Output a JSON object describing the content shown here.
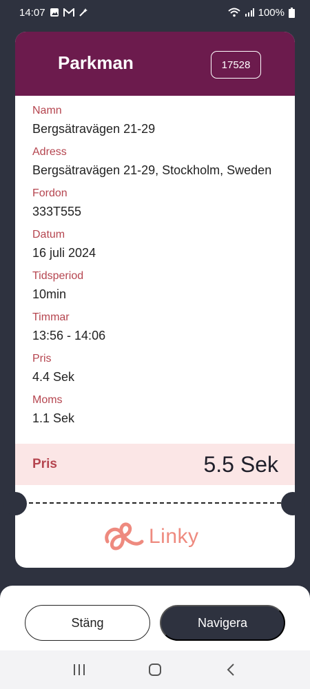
{
  "status_bar": {
    "time": "14:07",
    "battery": "100%",
    "icons_left": [
      "gallery-icon",
      "gmail-icon",
      "wand-icon"
    ],
    "icons_right": [
      "wifi-icon",
      "signal-icon",
      "battery-icon"
    ]
  },
  "receipt": {
    "title": "Parkman",
    "code": "17528",
    "details": [
      {
        "label": "Namn",
        "value": "Bergsätravägen 21-29"
      },
      {
        "label": "Adress",
        "value": "Bergsätravägen 21-29, Stockholm, Sweden"
      },
      {
        "label": "Fordon",
        "value": "333T555"
      },
      {
        "label": "Datum",
        "value": "16 juli 2024"
      },
      {
        "label": "Tidsperiod",
        "value": "10min"
      },
      {
        "label": "Timmar",
        "value": "13:56 - 14:06"
      },
      {
        "label": "Pris",
        "value": "4.4 Sek"
      },
      {
        "label": "Moms",
        "value": "1.1 Sek"
      }
    ],
    "total_label": "Pris",
    "total_value": "5.5 Sek",
    "brand": "Linky",
    "colors": {
      "header": "#6c1b4d",
      "label": "#b5454f",
      "total_bg": "#fbe6e6",
      "brand": "#ee8a7f"
    }
  },
  "actions": {
    "close_label": "Stäng",
    "navigate_label": "Navigera"
  },
  "nav_bar": {
    "icons": [
      "recents-icon",
      "home-icon",
      "back-icon"
    ]
  }
}
